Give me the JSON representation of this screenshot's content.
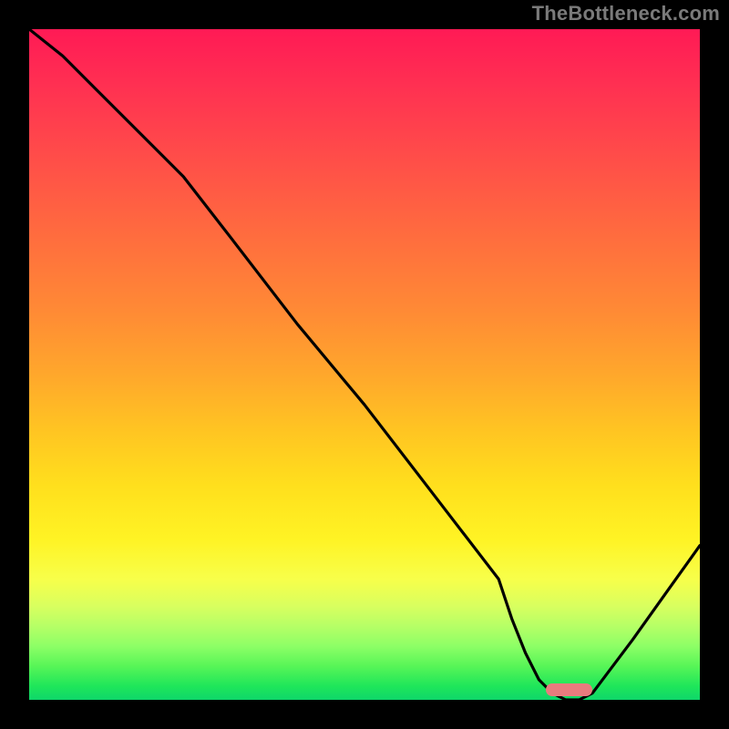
{
  "watermark": "TheBottleneck.com",
  "chart_data": {
    "type": "line",
    "title": "",
    "xlabel": "",
    "ylabel": "",
    "xlim": [
      0,
      100
    ],
    "ylim": [
      0,
      100
    ],
    "x": [
      0,
      5,
      10,
      15,
      20,
      23,
      30,
      40,
      50,
      60,
      70,
      72,
      74,
      76,
      78,
      80,
      82,
      84,
      90,
      95,
      100
    ],
    "values": [
      100,
      96,
      91,
      86,
      81,
      78,
      69,
      56,
      44,
      31,
      18,
      12,
      7,
      3,
      1,
      0,
      0,
      1,
      9,
      16,
      23
    ],
    "marker": {
      "x_from": 77,
      "x_to": 84,
      "y": 0
    },
    "background_gradient_stops": [
      {
        "pos": 0,
        "color": "#ff1a55"
      },
      {
        "pos": 18,
        "color": "#ff4a4a"
      },
      {
        "pos": 42,
        "color": "#ff8a35"
      },
      {
        "pos": 60,
        "color": "#ffc522"
      },
      {
        "pos": 76,
        "color": "#fff324"
      },
      {
        "pos": 92,
        "color": "#8dff66"
      },
      {
        "pos": 100,
        "color": "#0fd66a"
      }
    ]
  }
}
